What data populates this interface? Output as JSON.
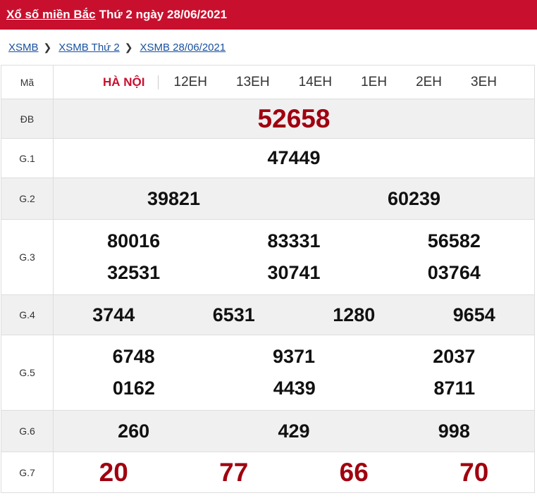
{
  "header": {
    "title_link": "Xổ số miền Bắc",
    "title_rest": "Thứ 2 ngày 28/06/2021"
  },
  "breadcrumb": [
    "XSMB",
    "XSMB Thứ 2",
    "XSMB 28/06/2021"
  ],
  "table": {
    "label_ma": "Mã",
    "province": "HÀ NỘI",
    "codes": [
      "12EH",
      "13EH",
      "14EH",
      "1EH",
      "2EH",
      "3EH"
    ],
    "labels": {
      "db": "ĐB",
      "g1": "G.1",
      "g2": "G.2",
      "g3": "G.3",
      "g4": "G.4",
      "g5": "G.5",
      "g6": "G.6",
      "g7": "G.7"
    },
    "db": "52658",
    "g1": "47449",
    "g2": [
      "39821",
      "60239"
    ],
    "g3": [
      "80016",
      "83331",
      "56582",
      "32531",
      "30741",
      "03764"
    ],
    "g4": [
      "3744",
      "6531",
      "1280",
      "9654"
    ],
    "g5": [
      "6748",
      "9371",
      "2037",
      "0162",
      "4439",
      "8711"
    ],
    "g6": [
      "260",
      "429",
      "998"
    ],
    "g7": [
      "20",
      "77",
      "66",
      "70"
    ]
  }
}
